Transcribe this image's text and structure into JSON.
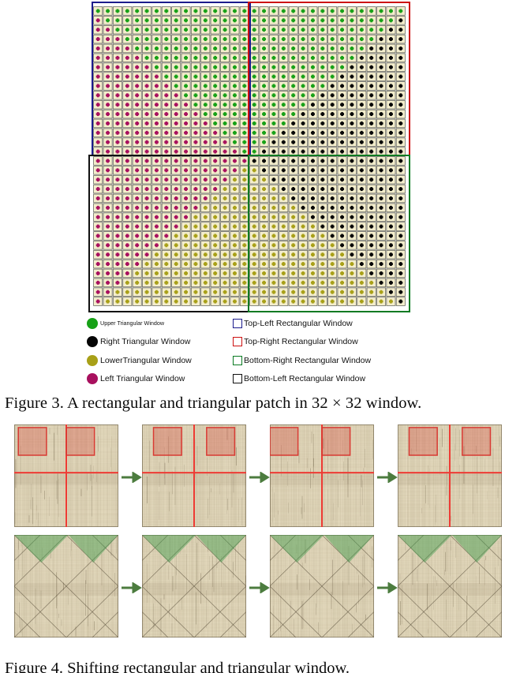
{
  "figure3": {
    "caption": "Figure 3. A rectangular and triangular patch in 32 × 32 window.",
    "grid": {
      "rows": 32,
      "cols": 32,
      "cell_background": "#f4eecd",
      "cell_border": "#6b6b60",
      "description": "32 x 32 cell window partitioned by its main diagonal and anti-diagonal into four triangular patches"
    },
    "triangles": [
      {
        "key": "upper",
        "label": "Upper Triangular Window",
        "color": "#17a117"
      },
      {
        "key": "right",
        "label": "Right Triangular Window",
        "color": "#050505"
      },
      {
        "key": "lower",
        "label": "LowerTriangular Window",
        "color": "#a8a018"
      },
      {
        "key": "left",
        "label": "Left Triangular Window",
        "color": "#a8105e"
      }
    ],
    "rectangles": [
      {
        "key": "top_left",
        "label": "Top-Left Rectangular Window",
        "color": "#1c1c8c"
      },
      {
        "key": "top_right",
        "label": "Top-Right Rectangular Window",
        "color": "#cc1111"
      },
      {
        "key": "bottom_right",
        "label": "Bottom-Right Rectangular Window",
        "color": "#0a7a22"
      },
      {
        "key": "bottom_left",
        "label": "Bottom-Left Rectangular Window",
        "color": "#111111"
      }
    ]
  },
  "figure4": {
    "caption": "Figure 4. Shifting rectangular and triangular window.",
    "arrow_color": "#4c7c3f",
    "rows": [
      {
        "key": "rectangular",
        "highlight_color": "#d83a33",
        "highlight_fill": "rgba(216,58,51,0.30)",
        "crosshair_color": "#ee3b34",
        "panels": [
          {
            "index": 1,
            "boxes": [
              {
                "x": 0.04,
                "y": 0.03,
                "w": 0.27,
                "h": 0.27
              },
              {
                "x": 0.5,
                "y": 0.03,
                "w": 0.27,
                "h": 0.27
              }
            ],
            "vline": 0.5,
            "hline": 0.47
          },
          {
            "index": 2,
            "boxes": [
              {
                "x": 0.11,
                "y": 0.03,
                "w": 0.27,
                "h": 0.27
              },
              {
                "x": 0.62,
                "y": 0.03,
                "w": 0.27,
                "h": 0.27
              }
            ],
            "vline": 0.5,
            "hline": 0.47
          },
          {
            "index": 3,
            "boxes": [
              {
                "x": 0.0,
                "y": 0.03,
                "w": 0.27,
                "h": 0.27
              },
              {
                "x": 0.5,
                "y": 0.03,
                "w": 0.27,
                "h": 0.27
              }
            ],
            "vline": 0.5,
            "hline": 0.47
          },
          {
            "index": 4,
            "boxes": [
              {
                "x": 0.11,
                "y": 0.03,
                "w": 0.27,
                "h": 0.27
              },
              {
                "x": 0.62,
                "y": 0.03,
                "w": 0.27,
                "h": 0.27
              }
            ],
            "vline": 0.5,
            "hline": 0.47
          }
        ]
      },
      {
        "key": "triangular",
        "highlight_color": "#3f9c4b",
        "highlight_fill": "rgba(63,156,75,0.45)",
        "panels": [
          {
            "index": 1,
            "tri_left": 0.0,
            "tri_right": 0.52,
            "tri_depth": 0.27
          },
          {
            "index": 2,
            "tri_left": 0.0,
            "tri_right": 0.52,
            "tri_depth": 0.27
          },
          {
            "index": 3,
            "tri_left": 0.0,
            "tri_right": 0.52,
            "tri_depth": 0.27
          },
          {
            "index": 4,
            "tri_left": 0.0,
            "tri_right": 0.52,
            "tri_depth": 0.27
          }
        ]
      }
    ]
  }
}
